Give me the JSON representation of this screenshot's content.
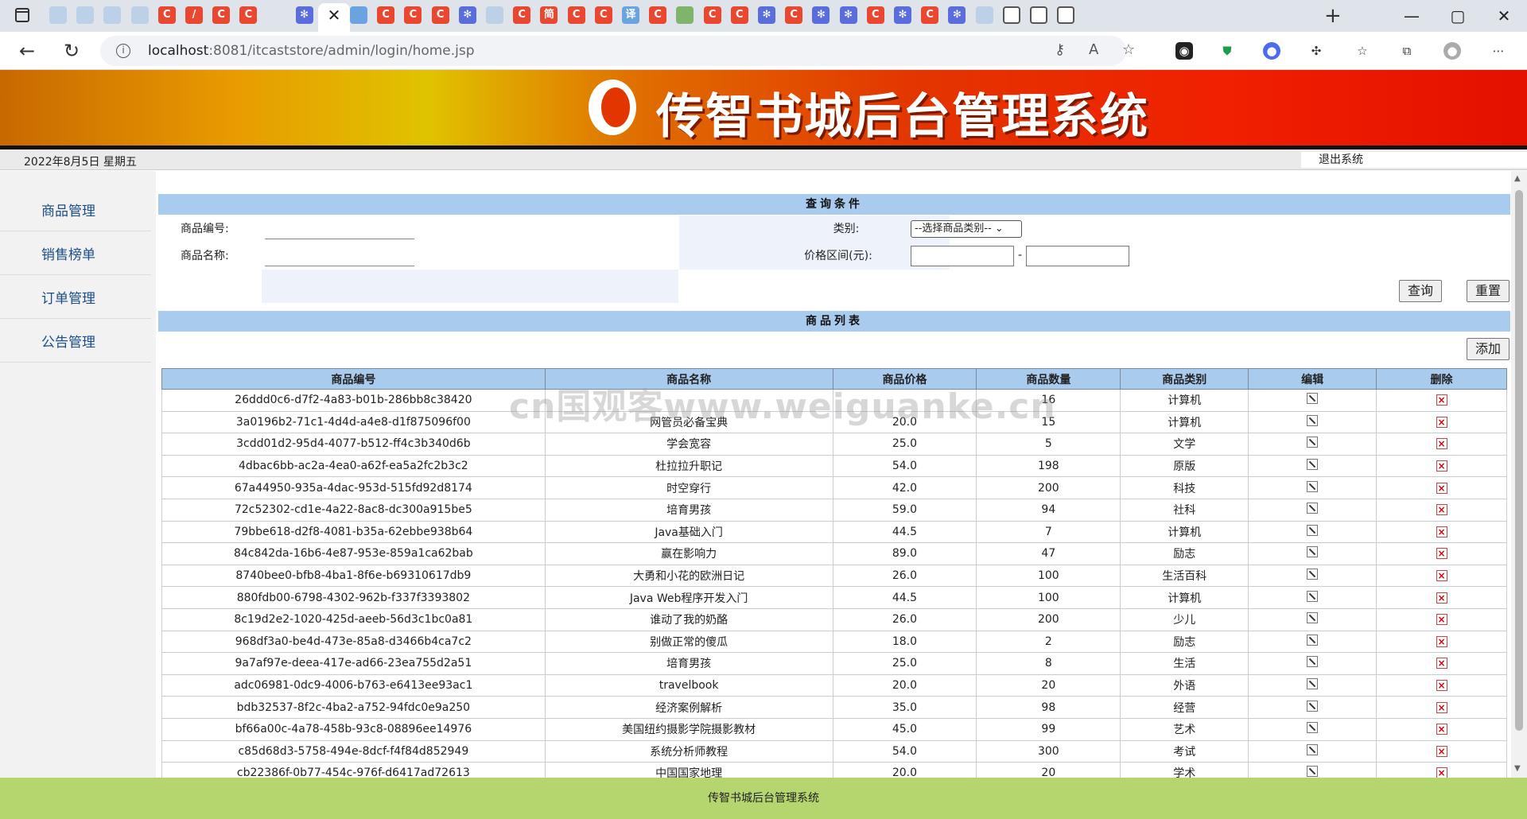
{
  "browser": {
    "url_host": "localhost",
    "url_rest": ":8081/itcaststore/admin/login/home.jsp",
    "tab_icons": [
      "cloud",
      "cloud",
      "cloud",
      "cloud",
      "c",
      "pen",
      "c",
      "c",
      "active",
      "paw",
      "c",
      "cloud-blue",
      "c",
      "c",
      "c",
      "paw",
      "cloud",
      "c",
      "jian",
      "c",
      "c",
      "yi",
      "c",
      "green",
      "c",
      "c",
      "paw",
      "c",
      "paw",
      "paw",
      "c",
      "paw",
      "c",
      "paw",
      "cloud",
      "doc",
      "doc",
      "doc"
    ],
    "tab_letters": {
      "c": "C",
      "jian": "简",
      "yi": "译",
      "paw": "✻",
      "pen": "/"
    },
    "new_tab_label": "+",
    "close_tab_label": "✕",
    "window_buttons": [
      "—",
      "▢",
      "✕"
    ]
  },
  "banner": {
    "title": "传智书城后台管理系统"
  },
  "datebar": {
    "date": "2022年8月5日 星期五",
    "logout": "退出系统"
  },
  "sidebar": {
    "items": [
      {
        "label": "商品管理"
      },
      {
        "label": "销售榜单"
      },
      {
        "label": "订单管理"
      },
      {
        "label": "公告管理"
      }
    ]
  },
  "query": {
    "header": "查询条件",
    "product_id_label": "商品编号:",
    "product_name_label": "商品名称:",
    "category_label": "类别:",
    "category_selected": "--选择商品类别--",
    "price_label": "价格区间(元):",
    "price_sep": "-",
    "search_button": "查询",
    "reset_button": "重置"
  },
  "list": {
    "header": "商品列表",
    "add_button": "添加",
    "columns": [
      "商品编号",
      "商品名称",
      "商品价格",
      "商品数量",
      "商品类别",
      "编辑",
      "删除"
    ],
    "rows": [
      [
        "26ddd0c6-d7f2-4a83-b01b-286bb8c38420",
        "",
        "",
        "16",
        "计算机"
      ],
      [
        "3a0196b2-71c1-4d4d-a4e8-d1f875096f00",
        "网管员必备宝典",
        "20.0",
        "15",
        "计算机"
      ],
      [
        "3cdd01d2-95d4-4077-b512-ff4c3b340d6b",
        "学会宽容",
        "25.0",
        "5",
        "文学"
      ],
      [
        "4dbac6bb-ac2a-4ea0-a62f-ea5a2fc2b3c2",
        "杜拉拉升职记",
        "54.0",
        "198",
        "原版"
      ],
      [
        "67a44950-935a-4dac-953d-515fd92d8174",
        "时空穿行",
        "42.0",
        "200",
        "科技"
      ],
      [
        "72c52302-cd1e-4a22-8ac8-dc300a915be5",
        "培育男孩",
        "59.0",
        "94",
        "社科"
      ],
      [
        "79bbe618-d2f8-4081-b35a-62ebbe938b64",
        "Java基础入门",
        "44.5",
        "7",
        "计算机"
      ],
      [
        "84c842da-16b6-4e87-953e-859a1ca62bab",
        "赢在影响力",
        "89.0",
        "47",
        "励志"
      ],
      [
        "8740bee0-bfb8-4ba1-8f6e-b69310617db9",
        "大勇和小花的欧洲日记",
        "26.0",
        "100",
        "生活百科"
      ],
      [
        "880fdb00-6798-4302-962b-f337f3393802",
        "Java Web程序开发入门",
        "44.5",
        "100",
        "计算机"
      ],
      [
        "8c19d2e2-1020-425d-aeeb-56d3c1bc0a81",
        "谁动了我的奶酪",
        "26.0",
        "200",
        "少儿"
      ],
      [
        "968df3a0-be4d-473e-85a8-d3466b4ca7c2",
        "别做正常的傻瓜",
        "18.0",
        "2",
        "励志"
      ],
      [
        "9a7af97e-deea-417e-ad66-23ea755d2a51",
        "培育男孩",
        "25.0",
        "8",
        "生活"
      ],
      [
        "adc06981-0dc9-4006-b763-e6413ee93ac1",
        "travelbook",
        "20.0",
        "20",
        "外语"
      ],
      [
        "bdb32537-8f2c-4ba2-a752-94fdc0e9a250",
        "经济案例解析",
        "35.0",
        "98",
        "经营"
      ],
      [
        "bf66a00c-4a78-458b-93c8-08896ee14976",
        "美国纽约摄影学院摄影教材",
        "45.0",
        "99",
        "艺术"
      ],
      [
        "c85d68d3-5758-494e-8dcf-f4f84d852949",
        "系统分析师教程",
        "54.0",
        "300",
        "考试"
      ],
      [
        "cb22386f-0b77-454c-976f-d6417ad72613",
        "中国国家地理",
        "20.0",
        "20",
        "学术"
      ]
    ]
  },
  "watermark": "cn国观客www.weiguanke.cn",
  "footer": "传智书城后台管理系统",
  "colors": {
    "section_header": "#a8cbee",
    "footer": "#b5d66e",
    "sidebar_text": "#1a4e8b"
  }
}
